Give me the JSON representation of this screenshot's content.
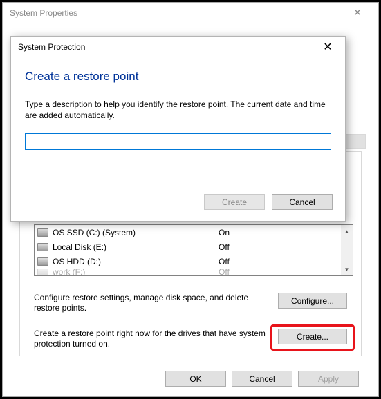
{
  "outer_window": {
    "title": "System Properties",
    "close_icon": "✕"
  },
  "tab_strip": {
    "visible_tab_fragment": ""
  },
  "drives": {
    "rows": [
      {
        "name": "OS SSD (C:) (System)",
        "status": "On"
      },
      {
        "name": "Local Disk (E:)",
        "status": "Off"
      },
      {
        "name": "OS HDD (D:)",
        "status": "Off"
      },
      {
        "name": "work (F:)",
        "status": "Off"
      }
    ]
  },
  "configure": {
    "text": "Configure restore settings, manage disk space, and delete restore points.",
    "button": "Configure..."
  },
  "create": {
    "text": "Create a restore point right now for the drives that have system protection turned on.",
    "button": "Create..."
  },
  "bottom": {
    "ok": "OK",
    "cancel": "Cancel",
    "apply": "Apply"
  },
  "modal": {
    "title": "System Protection",
    "close_icon": "✕",
    "heading": "Create a restore point",
    "description": "Type a description to help you identify the restore point. The current date and time are added automatically.",
    "input_value": "",
    "create_button": "Create",
    "cancel_button": "Cancel"
  }
}
